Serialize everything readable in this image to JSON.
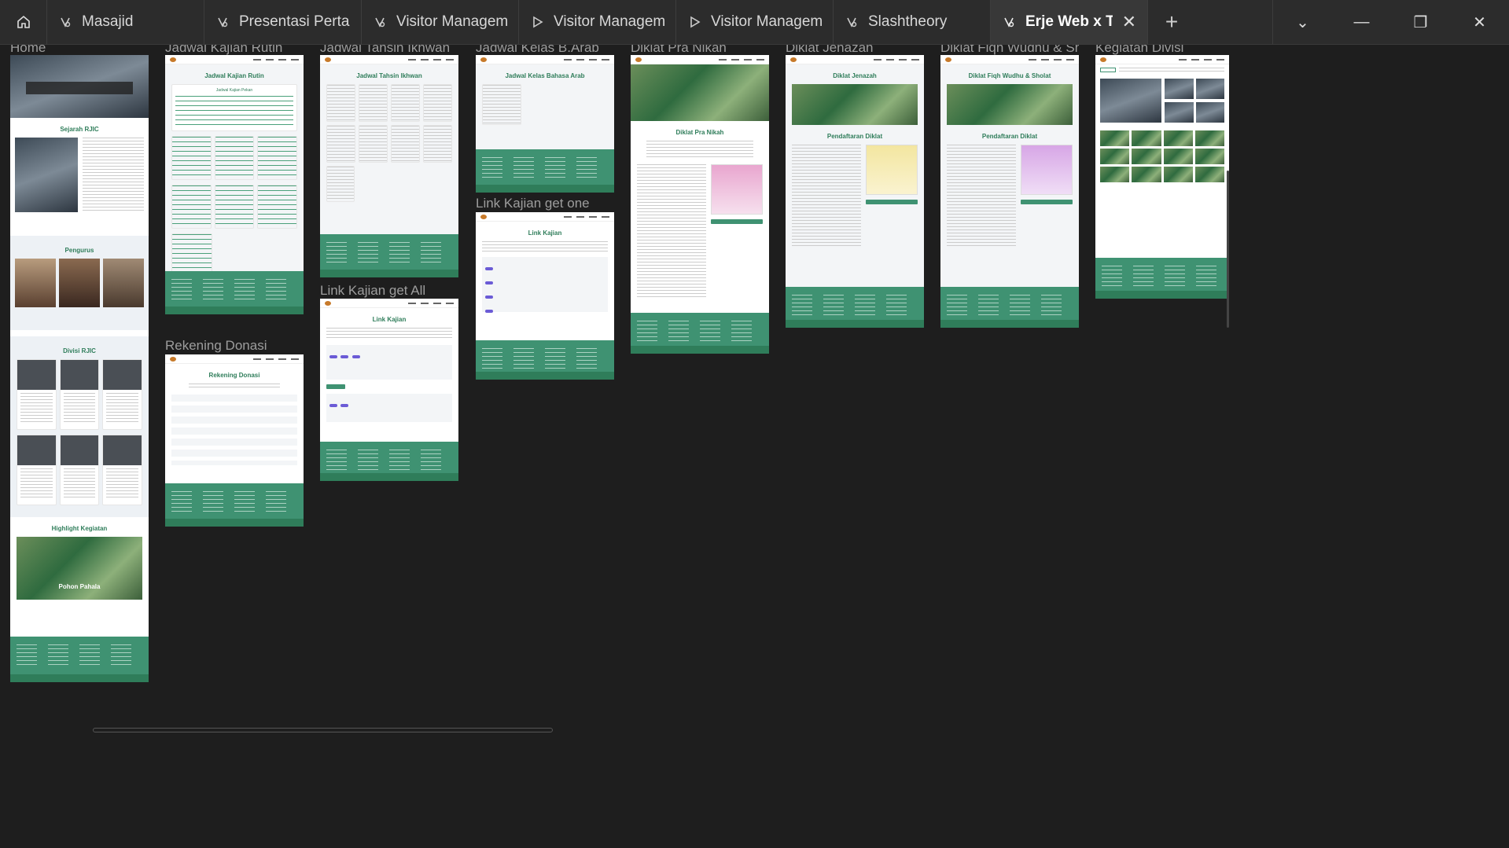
{
  "tabs": [
    {
      "label": "Masajid",
      "icon": "figma-icon"
    },
    {
      "label": "Presentasi Perta",
      "icon": "figma-icon"
    },
    {
      "label": "Visitor Managem",
      "icon": "figma-icon"
    },
    {
      "label": "Visitor Managem",
      "icon": "play-icon"
    },
    {
      "label": "Visitor Managem",
      "icon": "play-icon"
    },
    {
      "label": "Slashtheory",
      "icon": "figma-icon"
    },
    {
      "label": "Erje Web x T",
      "icon": "figma-icon",
      "active": true
    }
  ],
  "frames": {
    "home": {
      "label": "Home",
      "sejarah_title": "Sejarah RJIC",
      "pengurus_title": "Pengurus",
      "divisi_title": "Divisi RJIC",
      "highlight_title": "Highlight Kegiatan",
      "highlight_caption": "Pohon Pahala"
    },
    "kajian_rutin": {
      "label": "Jadwal Kajian Rutin",
      "title": "Jadwal Kajian Rutin",
      "subtitle": "Jadwal Kajian Pekan"
    },
    "rekening": {
      "label": "Rekening Donasi",
      "title": "Rekening Donasi"
    },
    "tahsin": {
      "label": "Jadwal Tahsin Ikhwan",
      "title": "Jadwal Tahsin Ikhwan"
    },
    "link_all": {
      "label": "Link Kajian get All",
      "title": "Link Kajian"
    },
    "kelas_arab": {
      "label": "Jadwal Kelas B.Arab",
      "title": "Jadwal Kelas Bahasa Arab"
    },
    "link_one": {
      "label": "Link Kajian get one",
      "title": "Link Kajian"
    },
    "pra_nikah": {
      "label": "Diklat Pra Nikah",
      "title": "Diklat Pra Nikah"
    },
    "jenazah": {
      "label": "Diklat Jenazah",
      "title": "Diklat Jenazah",
      "form_title": "Pendaftaran Diklat"
    },
    "fiqh": {
      "label": "Diklat Fiqh Wudhu & Sho...",
      "title": "Diklat Fiqh Wudhu & Sholat",
      "form_title": "Pendaftaran Diklat"
    },
    "divisi": {
      "label": "Kegiatan Divisi"
    }
  },
  "colors": {
    "accent": "#3f9272",
    "dark_green": "#2f7d5a",
    "canvas": "#1e1e1e",
    "tabbar": "#2c2c2c"
  }
}
